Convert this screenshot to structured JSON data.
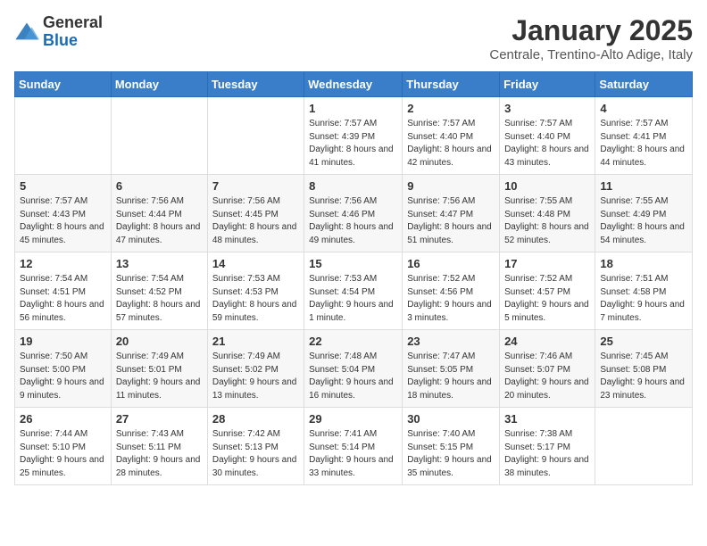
{
  "header": {
    "logo": {
      "general": "General",
      "blue": "Blue"
    },
    "title": "January 2025",
    "location": "Centrale, Trentino-Alto Adige, Italy"
  },
  "weekdays": [
    "Sunday",
    "Monday",
    "Tuesday",
    "Wednesday",
    "Thursday",
    "Friday",
    "Saturday"
  ],
  "weeks": [
    [
      {
        "day": "",
        "info": ""
      },
      {
        "day": "",
        "info": ""
      },
      {
        "day": "",
        "info": ""
      },
      {
        "day": "1",
        "info": "Sunrise: 7:57 AM\nSunset: 4:39 PM\nDaylight: 8 hours and 41 minutes."
      },
      {
        "day": "2",
        "info": "Sunrise: 7:57 AM\nSunset: 4:40 PM\nDaylight: 8 hours and 42 minutes."
      },
      {
        "day": "3",
        "info": "Sunrise: 7:57 AM\nSunset: 4:40 PM\nDaylight: 8 hours and 43 minutes."
      },
      {
        "day": "4",
        "info": "Sunrise: 7:57 AM\nSunset: 4:41 PM\nDaylight: 8 hours and 44 minutes."
      }
    ],
    [
      {
        "day": "5",
        "info": "Sunrise: 7:57 AM\nSunset: 4:43 PM\nDaylight: 8 hours and 45 minutes."
      },
      {
        "day": "6",
        "info": "Sunrise: 7:56 AM\nSunset: 4:44 PM\nDaylight: 8 hours and 47 minutes."
      },
      {
        "day": "7",
        "info": "Sunrise: 7:56 AM\nSunset: 4:45 PM\nDaylight: 8 hours and 48 minutes."
      },
      {
        "day": "8",
        "info": "Sunrise: 7:56 AM\nSunset: 4:46 PM\nDaylight: 8 hours and 49 minutes."
      },
      {
        "day": "9",
        "info": "Sunrise: 7:56 AM\nSunset: 4:47 PM\nDaylight: 8 hours and 51 minutes."
      },
      {
        "day": "10",
        "info": "Sunrise: 7:55 AM\nSunset: 4:48 PM\nDaylight: 8 hours and 52 minutes."
      },
      {
        "day": "11",
        "info": "Sunrise: 7:55 AM\nSunset: 4:49 PM\nDaylight: 8 hours and 54 minutes."
      }
    ],
    [
      {
        "day": "12",
        "info": "Sunrise: 7:54 AM\nSunset: 4:51 PM\nDaylight: 8 hours and 56 minutes."
      },
      {
        "day": "13",
        "info": "Sunrise: 7:54 AM\nSunset: 4:52 PM\nDaylight: 8 hours and 57 minutes."
      },
      {
        "day": "14",
        "info": "Sunrise: 7:53 AM\nSunset: 4:53 PM\nDaylight: 8 hours and 59 minutes."
      },
      {
        "day": "15",
        "info": "Sunrise: 7:53 AM\nSunset: 4:54 PM\nDaylight: 9 hours and 1 minute."
      },
      {
        "day": "16",
        "info": "Sunrise: 7:52 AM\nSunset: 4:56 PM\nDaylight: 9 hours and 3 minutes."
      },
      {
        "day": "17",
        "info": "Sunrise: 7:52 AM\nSunset: 4:57 PM\nDaylight: 9 hours and 5 minutes."
      },
      {
        "day": "18",
        "info": "Sunrise: 7:51 AM\nSunset: 4:58 PM\nDaylight: 9 hours and 7 minutes."
      }
    ],
    [
      {
        "day": "19",
        "info": "Sunrise: 7:50 AM\nSunset: 5:00 PM\nDaylight: 9 hours and 9 minutes."
      },
      {
        "day": "20",
        "info": "Sunrise: 7:49 AM\nSunset: 5:01 PM\nDaylight: 9 hours and 11 minutes."
      },
      {
        "day": "21",
        "info": "Sunrise: 7:49 AM\nSunset: 5:02 PM\nDaylight: 9 hours and 13 minutes."
      },
      {
        "day": "22",
        "info": "Sunrise: 7:48 AM\nSunset: 5:04 PM\nDaylight: 9 hours and 16 minutes."
      },
      {
        "day": "23",
        "info": "Sunrise: 7:47 AM\nSunset: 5:05 PM\nDaylight: 9 hours and 18 minutes."
      },
      {
        "day": "24",
        "info": "Sunrise: 7:46 AM\nSunset: 5:07 PM\nDaylight: 9 hours and 20 minutes."
      },
      {
        "day": "25",
        "info": "Sunrise: 7:45 AM\nSunset: 5:08 PM\nDaylight: 9 hours and 23 minutes."
      }
    ],
    [
      {
        "day": "26",
        "info": "Sunrise: 7:44 AM\nSunset: 5:10 PM\nDaylight: 9 hours and 25 minutes."
      },
      {
        "day": "27",
        "info": "Sunrise: 7:43 AM\nSunset: 5:11 PM\nDaylight: 9 hours and 28 minutes."
      },
      {
        "day": "28",
        "info": "Sunrise: 7:42 AM\nSunset: 5:13 PM\nDaylight: 9 hours and 30 minutes."
      },
      {
        "day": "29",
        "info": "Sunrise: 7:41 AM\nSunset: 5:14 PM\nDaylight: 9 hours and 33 minutes."
      },
      {
        "day": "30",
        "info": "Sunrise: 7:40 AM\nSunset: 5:15 PM\nDaylight: 9 hours and 35 minutes."
      },
      {
        "day": "31",
        "info": "Sunrise: 7:38 AM\nSunset: 5:17 PM\nDaylight: 9 hours and 38 minutes."
      },
      {
        "day": "",
        "info": ""
      }
    ]
  ]
}
